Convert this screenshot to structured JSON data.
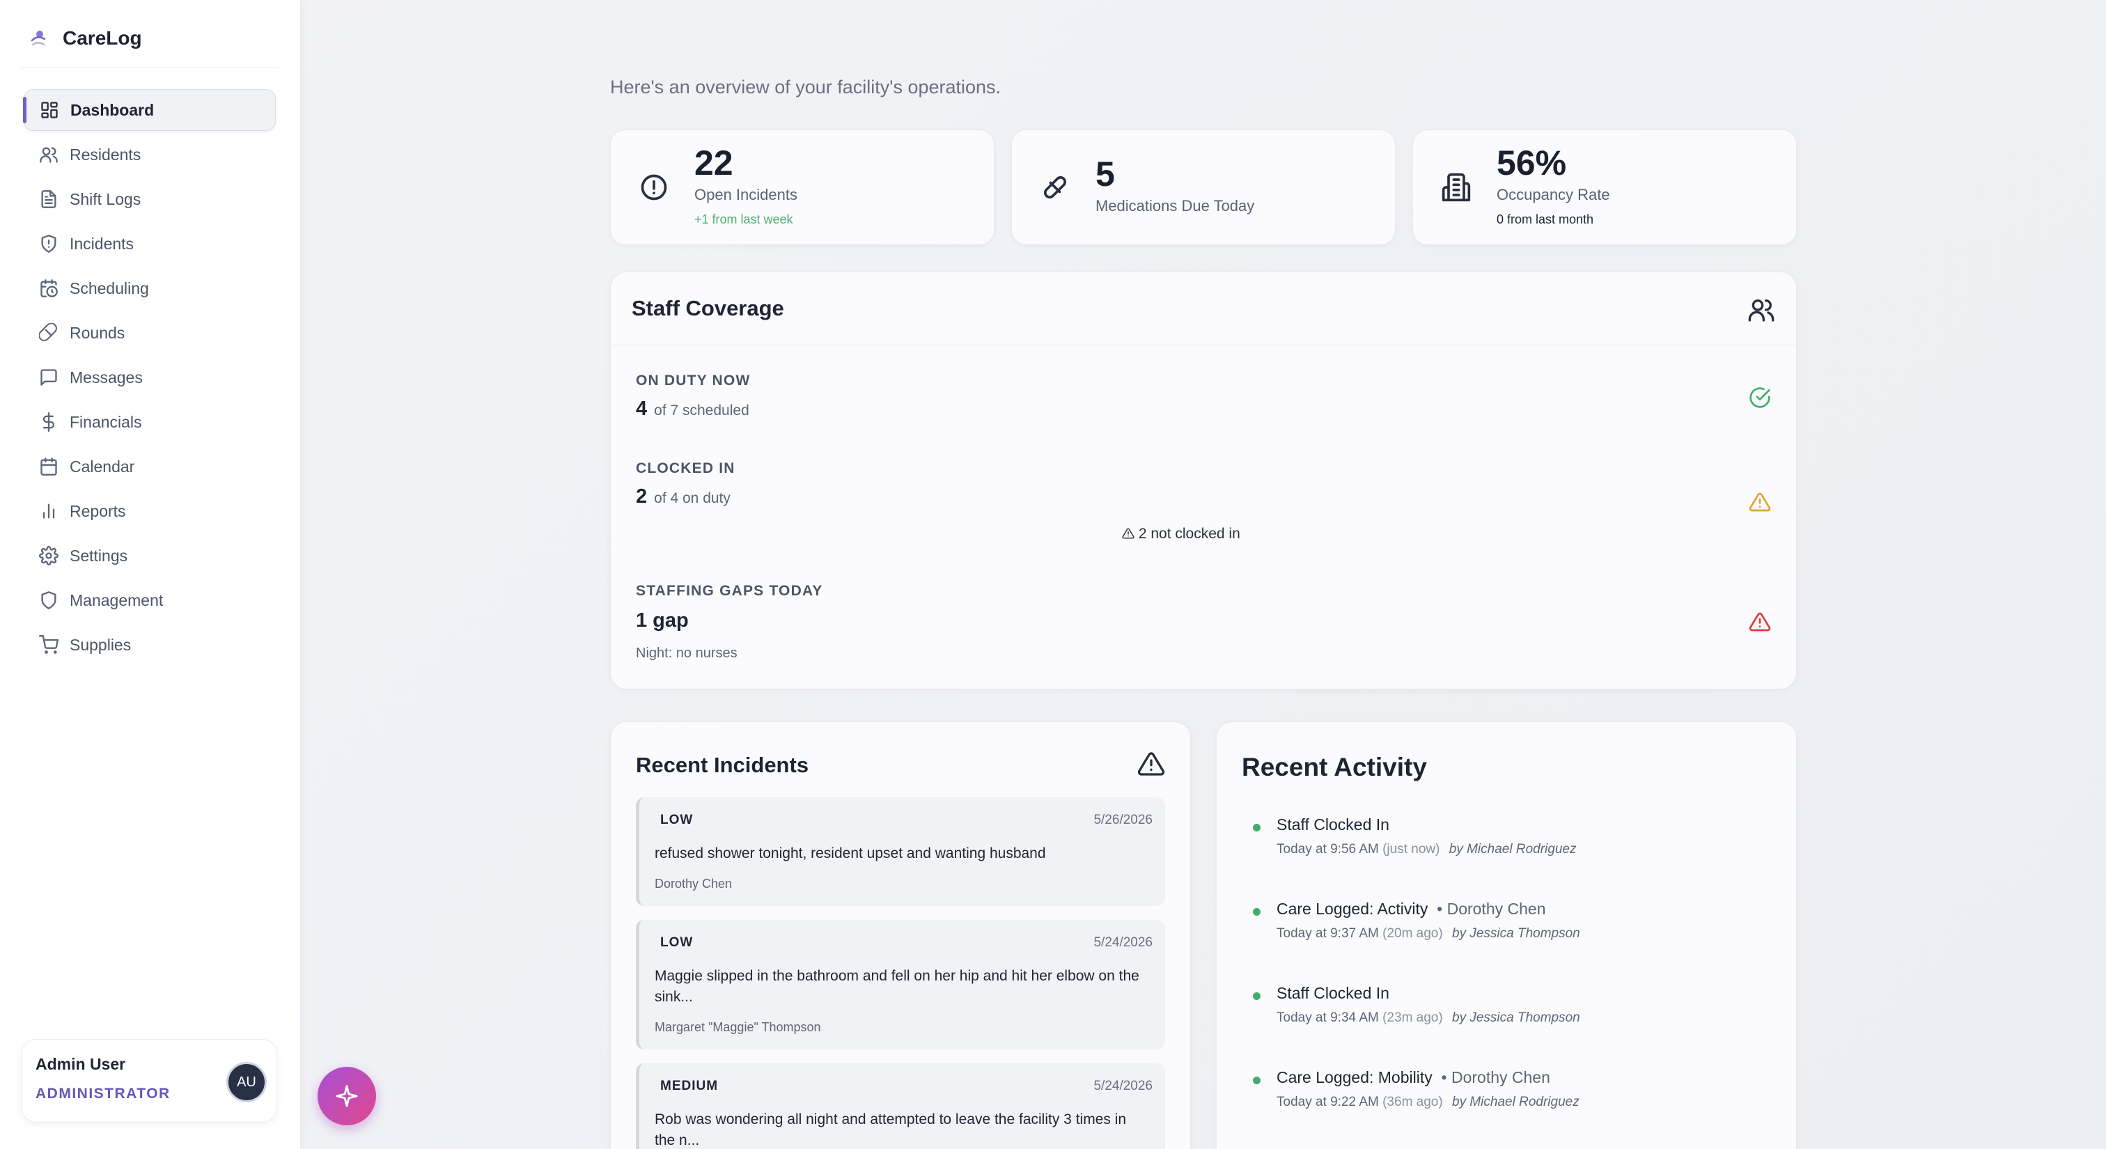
{
  "app": {
    "name": "CareLog"
  },
  "sidebar": {
    "items": [
      {
        "label": "Dashboard",
        "icon": "dashboard-icon"
      },
      {
        "label": "Residents",
        "icon": "users-icon"
      },
      {
        "label": "Shift Logs",
        "icon": "file-text-icon"
      },
      {
        "label": "Incidents",
        "icon": "shield-alert-icon"
      },
      {
        "label": "Scheduling",
        "icon": "calendar-clock-icon"
      },
      {
        "label": "Rounds",
        "icon": "pill-icon"
      },
      {
        "label": "Messages",
        "icon": "message-icon"
      },
      {
        "label": "Financials",
        "icon": "dollar-icon"
      },
      {
        "label": "Calendar",
        "icon": "calendar-icon"
      },
      {
        "label": "Reports",
        "icon": "bar-chart-icon"
      },
      {
        "label": "Settings",
        "icon": "gear-icon"
      },
      {
        "label": "Management",
        "icon": "shield-icon"
      },
      {
        "label": "Supplies",
        "icon": "cart-icon"
      }
    ],
    "active_index": 0,
    "user": {
      "name": "Admin User",
      "role": "ADMINISTRATOR",
      "initials": "AU"
    }
  },
  "header": {
    "subtitle": "Here's an overview of your facility's operations."
  },
  "stats": [
    {
      "value": "22",
      "label": "Open Incidents",
      "sub": "+1 from last week",
      "icon": "alert-circle-icon"
    },
    {
      "value": "5",
      "label": "Medications Due Today",
      "icon": "pill-icon"
    },
    {
      "value": "56%",
      "label": "Occupancy Rate",
      "sub": "0 from last month",
      "icon": "building-icon"
    }
  ],
  "coverage": {
    "title": "Staff Coverage",
    "on_duty": {
      "label": "ON DUTY NOW",
      "value": "4",
      "of": "of 7 scheduled"
    },
    "clocked_in": {
      "label": "CLOCKED IN",
      "value": "2",
      "of": "of 4 on duty",
      "warning": "2 not clocked in"
    },
    "gaps": {
      "label": "STAFFING GAPS TODAY",
      "value": "1 gap",
      "note": "Night: no nurses"
    }
  },
  "incidents": {
    "title": "Recent Incidents",
    "items": [
      {
        "severity": "LOW",
        "date": "5/26/2026",
        "text": "refused shower tonight, resident upset and wanting husband",
        "resident": "Dorothy Chen"
      },
      {
        "severity": "LOW",
        "date": "5/24/2026",
        "text": "Maggie slipped in the bathroom and fell on her hip and hit her elbow on the sink...",
        "resident": "Margaret \"Maggie\" Thompson"
      },
      {
        "severity": "MEDIUM",
        "date": "5/24/2026",
        "text": "Rob was wondering all night and attempted to leave the facility 3 times in the n..."
      }
    ]
  },
  "activity": {
    "title": "Recent Activity",
    "items": [
      {
        "title": "Staff Clocked In",
        "resident": "",
        "time": "Today at 9:56 AM",
        "ago": "(just now)",
        "by": "by Michael Rodriguez"
      },
      {
        "title": "Care Logged: Activity",
        "resident": "Dorothy Chen",
        "time": "Today at 9:37 AM",
        "ago": "(20m ago)",
        "by": "by Jessica Thompson"
      },
      {
        "title": "Staff Clocked In",
        "resident": "",
        "time": "Today at 9:34 AM",
        "ago": "(23m ago)",
        "by": "by Jessica Thompson"
      },
      {
        "title": "Care Logged: Mobility",
        "resident": "Dorothy Chen",
        "time": "Today at 9:22 AM",
        "ago": "(36m ago)",
        "by": "by Michael Rodriguez"
      }
    ]
  },
  "colors": {
    "accent": "#6f62c9",
    "success": "#3fae6a",
    "warning": "#e0a23a",
    "danger": "#dc3b3b",
    "fab_start": "#a74fd6",
    "fab_end": "#e0498e"
  }
}
